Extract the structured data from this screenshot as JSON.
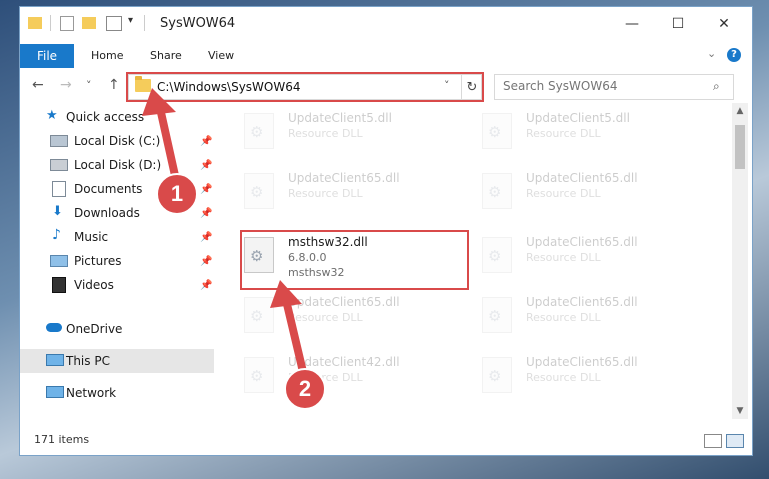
{
  "window": {
    "title": "SysWOW64",
    "controls": {
      "minimize": "—",
      "maximize": "☐",
      "close": "✕"
    }
  },
  "ribbon": {
    "tabs": [
      {
        "label": "File"
      },
      {
        "label": "Home"
      },
      {
        "label": "Share"
      },
      {
        "label": "View"
      }
    ],
    "help": "?",
    "collapse": "⌄"
  },
  "navigation": {
    "back": "←",
    "forward": "→",
    "recent": "˅",
    "up": "↑",
    "address": "C:\\Windows\\SysWOW64",
    "address_dropdown": "˅",
    "refresh": "↻",
    "search_placeholder": "Search SysWOW64",
    "search_icon": "⌕"
  },
  "sidebar": {
    "items": [
      {
        "label": "Quick access",
        "icon": "star-icon"
      },
      {
        "label": "Local Disk (C:)",
        "icon": "drive-icon",
        "pinned": true
      },
      {
        "label": "Local Disk (D:)",
        "icon": "drive-icon",
        "pinned": true
      },
      {
        "label": "Documents",
        "icon": "documents-icon",
        "pinned": true
      },
      {
        "label": "Downloads",
        "icon": "download-icon",
        "pinned": true
      },
      {
        "label": "Music",
        "icon": "music-icon",
        "pinned": true
      },
      {
        "label": "Pictures",
        "icon": "pictures-icon",
        "pinned": true
      },
      {
        "label": "Videos",
        "icon": "videos-icon",
        "pinned": true
      },
      {
        "label": "OneDrive",
        "icon": "cloud-icon"
      },
      {
        "label": "This PC",
        "icon": "computer-icon",
        "selected": true
      },
      {
        "label": "Network",
        "icon": "network-icon"
      }
    ],
    "pin_glyph": "📌"
  },
  "files": [
    {
      "name": "UpdateClient5.dll",
      "line1": "Resource DLL",
      "line2": "",
      "faded": true
    },
    {
      "name": "UpdateClient5.dll",
      "line1": "Resource DLL",
      "line2": "",
      "faded": true
    },
    {
      "name": "UpdateClient65.dll",
      "line1": "Resource DLL",
      "line2": "",
      "faded": true
    },
    {
      "name": "UpdateClient65.dll",
      "line1": "Resource DLL",
      "line2": "",
      "faded": true
    },
    {
      "name": "msthsw32.dll",
      "line1": "6.8.0.0",
      "line2": "msthsw32",
      "faded": false
    },
    {
      "name": "UpdateClient65.dll",
      "line1": "Resource DLL",
      "line2": "",
      "faded": true
    },
    {
      "name": "UpdateClient65.dll",
      "line1": "Resource DLL",
      "line2": "",
      "faded": true
    },
    {
      "name": "UpdateClient65.dll",
      "line1": "Resource DLL",
      "line2": "",
      "faded": true
    },
    {
      "name": "UpdateClient42.dll",
      "line1": "Resource DLL",
      "line2": "",
      "faded": true
    },
    {
      "name": "UpdateClient65.dll",
      "line1": "Resource DLL",
      "line2": "",
      "faded": true
    }
  ],
  "status": {
    "items": "171 items"
  },
  "callouts": {
    "one": "1",
    "two": "2"
  },
  "colors": {
    "accent": "#1979ca",
    "highlight": "#d94a4a"
  }
}
